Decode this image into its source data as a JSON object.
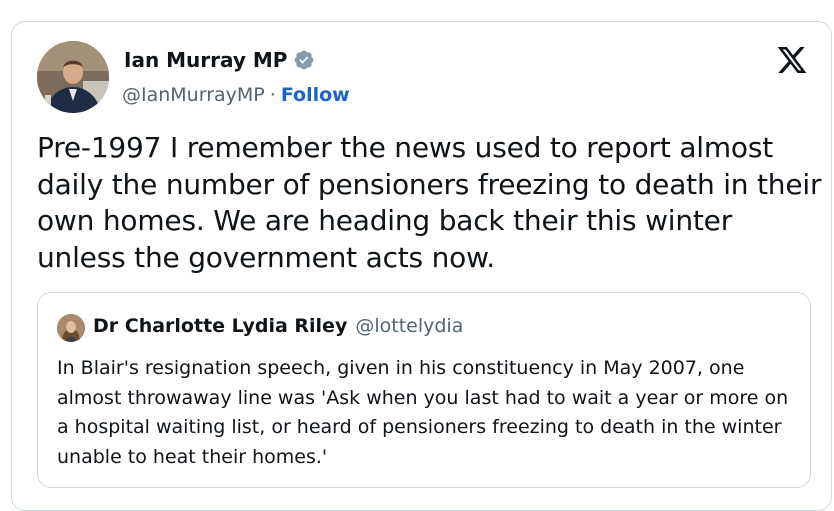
{
  "author": {
    "name": "Ian Murray MP",
    "handle": "@IanMurrayMP",
    "separator": "·",
    "follow_label": "Follow"
  },
  "tweet": {
    "text": "Pre-1997 I remember the news used to report almost daily the number of pensioners freezing to death in their own homes. We are heading back their this winter unless the government acts now."
  },
  "quoted_tweet": {
    "author_name": "Dr Charlotte Lydia Riley",
    "author_handle": "@lottelydia",
    "text": "In Blair's resignation speech, given in his constituency in May 2007, one almost throwaway line was 'Ask when you last had to wait a year or more on a hospital waiting list, or heard of pensioners freezing to death in the winter unable to heat their homes.'"
  },
  "icons": {
    "verified": "verified-badge-icon",
    "platform": "x-logo-icon"
  },
  "colors": {
    "text": "#0f1419",
    "muted": "#536471",
    "follow": "#1d64c9",
    "verified_badge": "#829aab",
    "border": "#cfd9de"
  }
}
